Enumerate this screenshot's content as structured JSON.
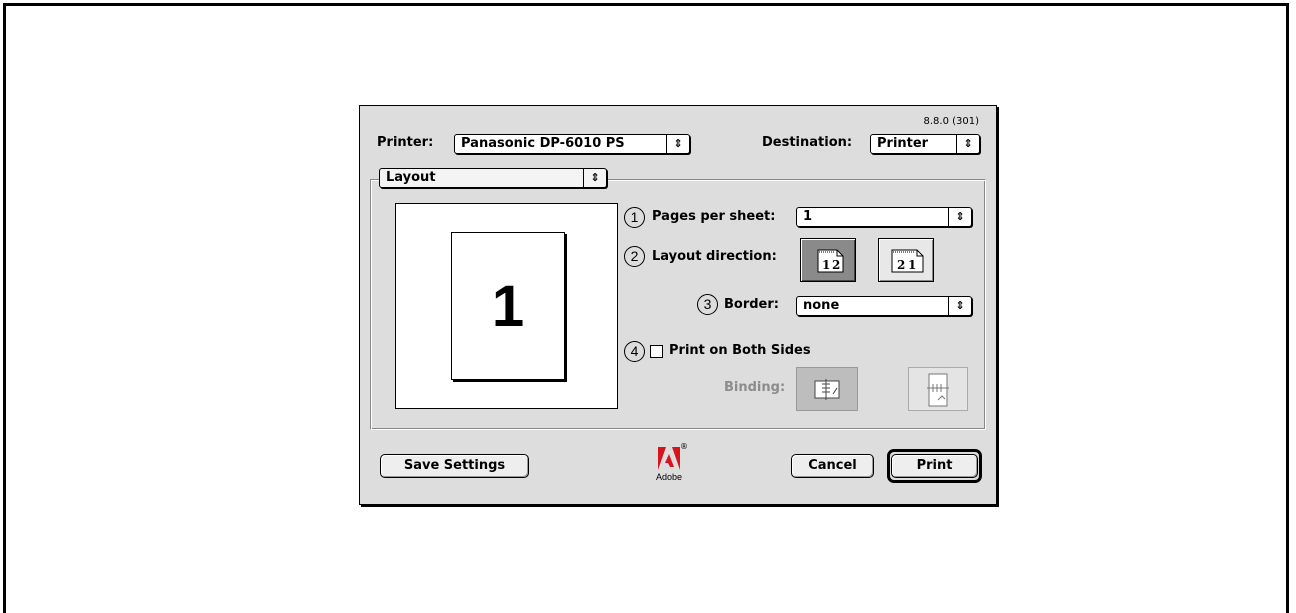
{
  "dialog": {
    "version": "8.8.0 (301)",
    "printer": {
      "label": "Printer:",
      "value": "Panasonic DP-6010 PS",
      "arrow": "⇕"
    },
    "destination": {
      "label": "Destination:",
      "value": "Printer",
      "arrow": "⇕"
    },
    "panel": {
      "value": "Layout",
      "arrow": "⇕"
    },
    "preview": {
      "page_number": "1"
    },
    "pages_per_sheet": {
      "number": "1",
      "label": "Pages per sheet:",
      "value": "1",
      "arrow": "⇕"
    },
    "layout_direction": {
      "number": "2",
      "label": "Layout direction:",
      "options": [
        {
          "icon": "layout-left-to-right-icon",
          "text": "1 2",
          "selected": true
        },
        {
          "icon": "layout-right-to-left-icon",
          "text": "2 1",
          "selected": false
        }
      ]
    },
    "border": {
      "number": "3",
      "label": "Border:",
      "value": "none",
      "arrow": "⇕"
    },
    "both_sides": {
      "number": "4",
      "label": "Print on Both Sides",
      "checked": false
    },
    "binding": {
      "label": "Binding:",
      "options": [
        {
          "icon": "binding-long-edge-icon",
          "enabled": false
        },
        {
          "icon": "binding-short-edge-icon",
          "enabled": false
        }
      ]
    },
    "buttons": {
      "save": "Save Settings",
      "cancel": "Cancel",
      "print": "Print"
    },
    "logo": {
      "text": "Adobe",
      "registered": "®"
    }
  }
}
